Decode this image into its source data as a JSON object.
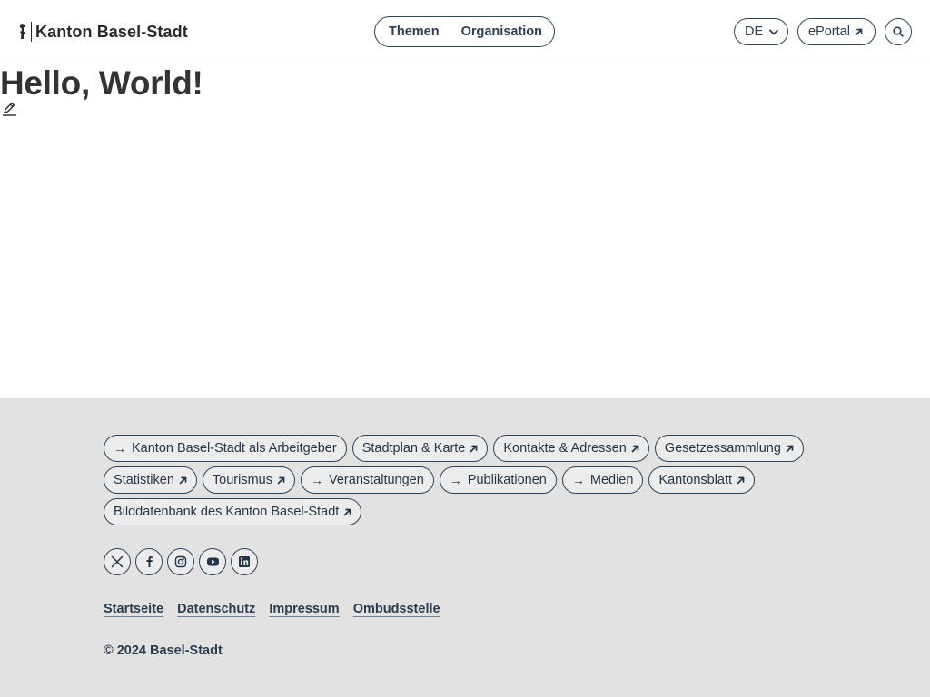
{
  "header": {
    "site_name": "Kanton Basel-Stadt",
    "nav": [
      {
        "label": "Themen"
      },
      {
        "label": "Organisation"
      }
    ],
    "language": "DE",
    "eportal_label": "ePortal"
  },
  "main": {
    "title": "Hello, World!"
  },
  "footer": {
    "chip_rows": [
      [
        {
          "label": "Kanton Basel-Stadt als Arbeitgeber",
          "type": "internal"
        },
        {
          "label": "Stadtplan & Karte",
          "type": "external"
        },
        {
          "label": "Kontakte & Adressen",
          "type": "external"
        },
        {
          "label": "Gesetzessammlung",
          "type": "external"
        }
      ],
      [
        {
          "label": "Statistiken",
          "type": "external"
        },
        {
          "label": "Tourismus",
          "type": "external"
        },
        {
          "label": "Veranstaltungen",
          "type": "internal"
        },
        {
          "label": "Publikationen",
          "type": "internal"
        },
        {
          "label": "Medien",
          "type": "internal"
        },
        {
          "label": "Kantonsblatt",
          "type": "external"
        }
      ],
      [
        {
          "label": "Bilddatenbank des Kanton Basel-Stadt",
          "type": "external"
        }
      ]
    ],
    "socials": [
      {
        "icon": "x-twitter-icon"
      },
      {
        "icon": "facebook-icon"
      },
      {
        "icon": "instagram-icon"
      },
      {
        "icon": "youtube-icon"
      },
      {
        "icon": "linkedin-icon"
      }
    ],
    "legal_links": [
      "Startseite",
      "Datenschutz",
      "Impressum",
      "Ombudsstelle"
    ],
    "copyright": "© 2024 Basel-Stadt"
  },
  "colors": {
    "accent": "#2a3d52",
    "footer_bg": "#e2e2e2",
    "text": "#333333"
  }
}
